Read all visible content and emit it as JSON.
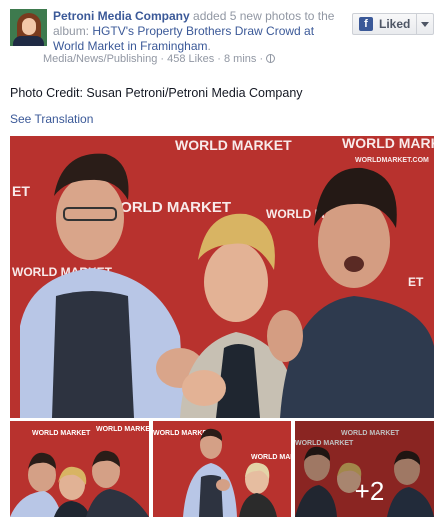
{
  "post": {
    "page_name": "Petroni Media Company",
    "action_text": " added 5 new photos to the album: ",
    "album_title": "HGTV's Property Brothers Draw Crowd at World Market in Framingham",
    "album_suffix": ".",
    "category": "Media/News/Publishing",
    "separator": " · ",
    "likes": "458 Likes",
    "time": "8 mins",
    "caption": "Photo Credit: Susan Petroni/Petroni Media Company",
    "see_translation": "See Translation"
  },
  "like_button": {
    "icon": "f",
    "label": "Liked"
  },
  "photos": {
    "backdrop_text": "WORLD MARKET",
    "backdrop_url": "WORLDMARKET.COM",
    "more_count": "+2"
  },
  "colors": {
    "link": "#3b5998",
    "backdrop_red": "#b32a2a"
  }
}
